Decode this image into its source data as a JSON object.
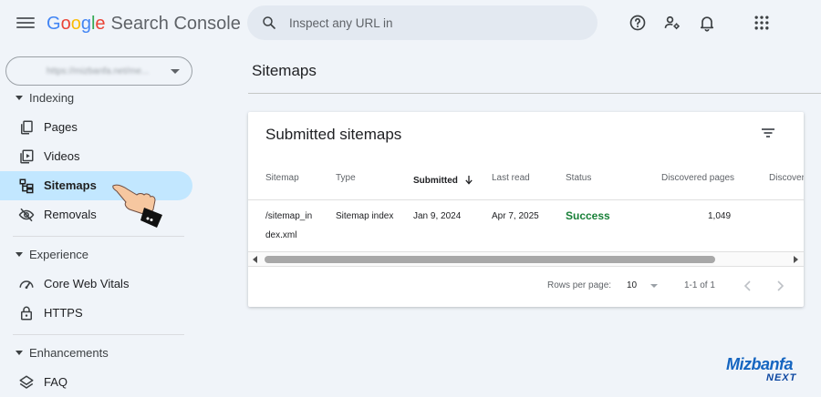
{
  "header": {
    "logo": {
      "g1": "G",
      "o1": "o",
      "o2": "o",
      "g2": "g",
      "l": "l",
      "e": "e",
      "product": "Search Console"
    },
    "search_placeholder": "Inspect any URL in",
    "icons": [
      "menu-icon",
      "search-icon",
      "help-icon",
      "manage-users-icon",
      "notifications-icon",
      "apps-grid-icon"
    ]
  },
  "sidebar": {
    "property_selector": "https://mizbanfa.net/me...",
    "sections": [
      {
        "label": "Indexing",
        "items": [
          {
            "label": "Pages",
            "icon": "pages-icon"
          },
          {
            "label": "Videos",
            "icon": "videos-icon"
          },
          {
            "label": "Sitemaps",
            "icon": "sitemaps-icon",
            "active": true
          },
          {
            "label": "Removals",
            "icon": "removals-icon"
          }
        ]
      },
      {
        "label": "Experience",
        "items": [
          {
            "label": "Core Web Vitals",
            "icon": "speed-icon"
          },
          {
            "label": "HTTPS",
            "icon": "lock-icon"
          }
        ]
      },
      {
        "label": "Enhancements",
        "items": [
          {
            "label": "FAQ",
            "icon": "layers-icon"
          }
        ]
      }
    ]
  },
  "main": {
    "page_title": "Sitemaps",
    "card": {
      "title": "Submitted sitemaps",
      "columns": [
        "Sitemap",
        "Type",
        "Submitted",
        "Last read",
        "Status",
        "Discovered pages",
        "Discover"
      ],
      "rows": [
        {
          "sitemap_line1": "/sitemap_in",
          "sitemap_line2": "dex.xml",
          "type": "Sitemap index",
          "submitted": "Jan 9, 2024",
          "last_read": "Apr 7, 2025",
          "status": "Success",
          "discovered_pages": "1,049"
        }
      ],
      "pagination": {
        "rows_label": "Rows per page:",
        "rows_value": "10",
        "range": "1-1 of 1"
      }
    }
  },
  "watermark": {
    "line1": "Mizbanfa",
    "line2": "NEXT"
  },
  "colors": {
    "active_nav": "#c2e7ff",
    "success": "#188038",
    "background": "#f0f4f9"
  }
}
